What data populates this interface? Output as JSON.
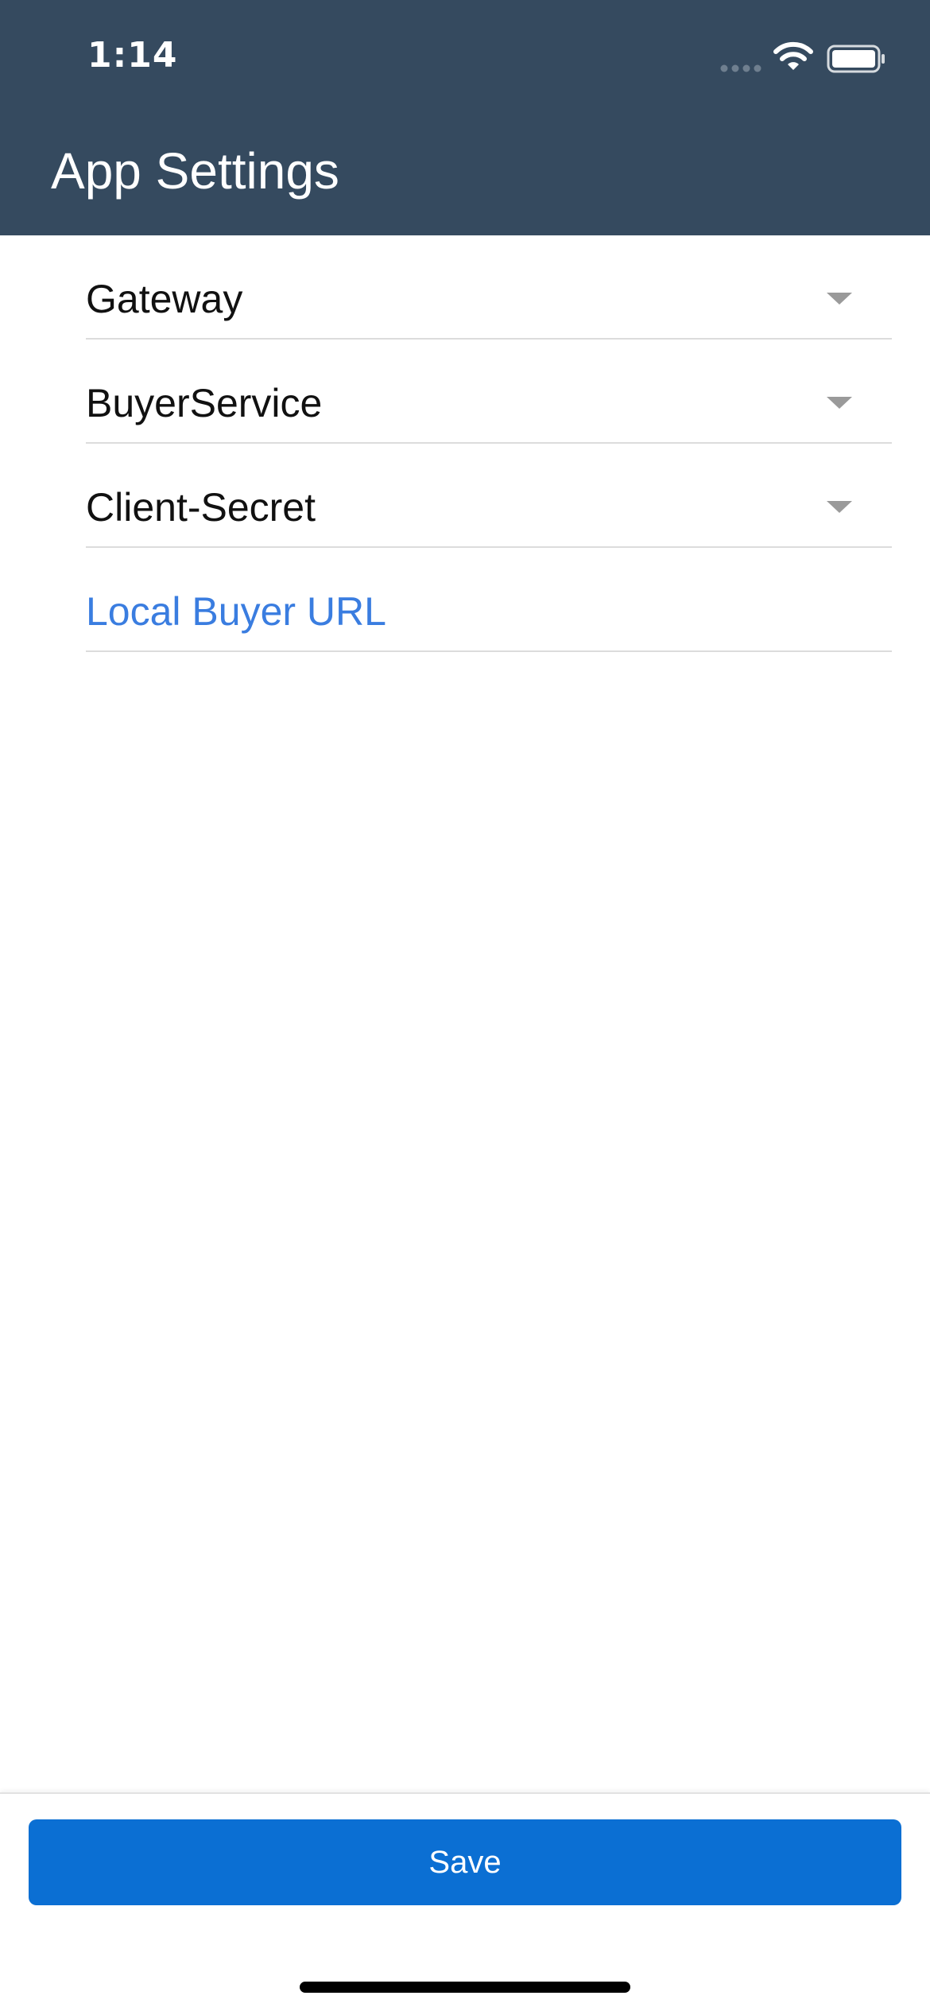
{
  "status_bar": {
    "time": "1:14",
    "signal_icon": "signal-dots-icon",
    "wifi_icon": "wifi-icon",
    "battery_icon": "battery-icon"
  },
  "header": {
    "title": "App Settings",
    "background_color": "#354a5f"
  },
  "settings": {
    "items": [
      {
        "label": "Gateway",
        "type": "dropdown",
        "icon": "chevron-down-icon"
      },
      {
        "label": "BuyerService",
        "type": "dropdown",
        "icon": "chevron-down-icon"
      },
      {
        "label": "Client-Secret",
        "type": "dropdown",
        "icon": "chevron-down-icon"
      },
      {
        "label": "Local Buyer URL",
        "type": "link",
        "color": "#3a7de0"
      }
    ]
  },
  "footer": {
    "save_label": "Save",
    "save_color": "#0b6fd3"
  }
}
